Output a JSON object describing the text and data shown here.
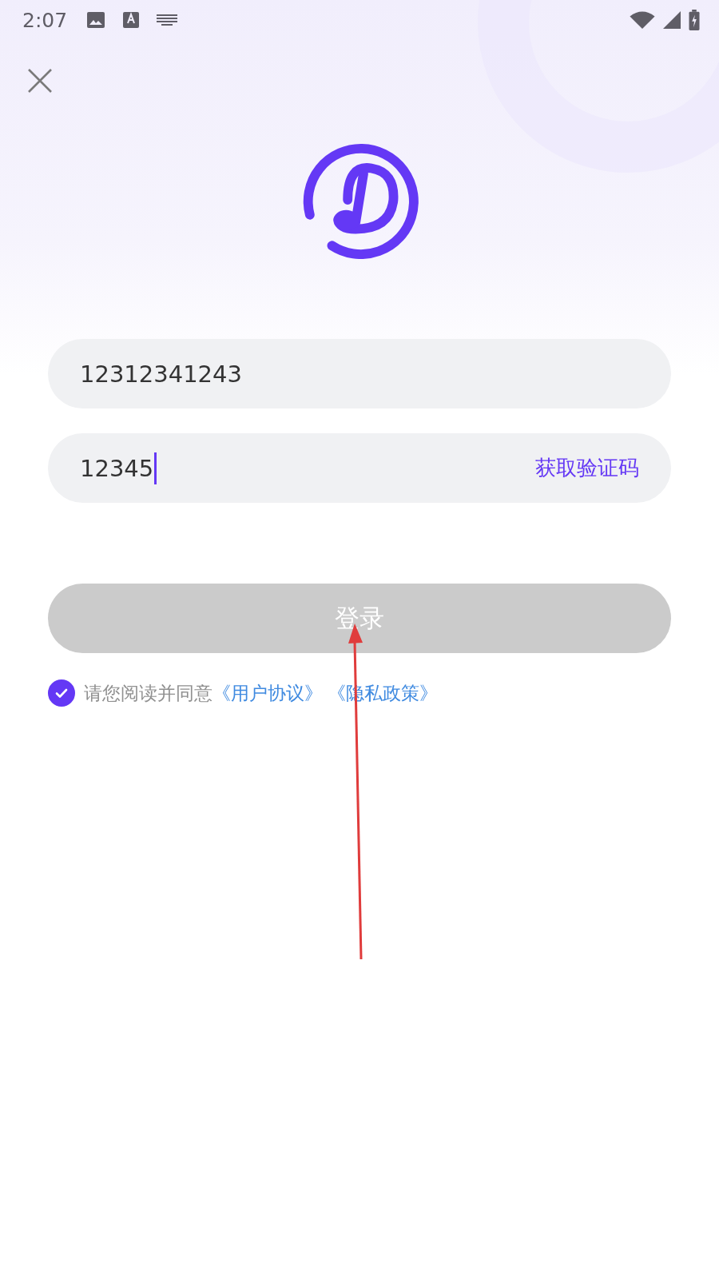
{
  "status_bar": {
    "time": "2:07"
  },
  "phone_field": {
    "value": "12312341243"
  },
  "code_field": {
    "value": "12345",
    "action": "获取验证码"
  },
  "login_button": {
    "label": "登录",
    "disabled": true
  },
  "agreement": {
    "checked": true,
    "text": "请您阅读并同意",
    "links": [
      "《用户协议》",
      "《隐私政策》"
    ]
  }
}
